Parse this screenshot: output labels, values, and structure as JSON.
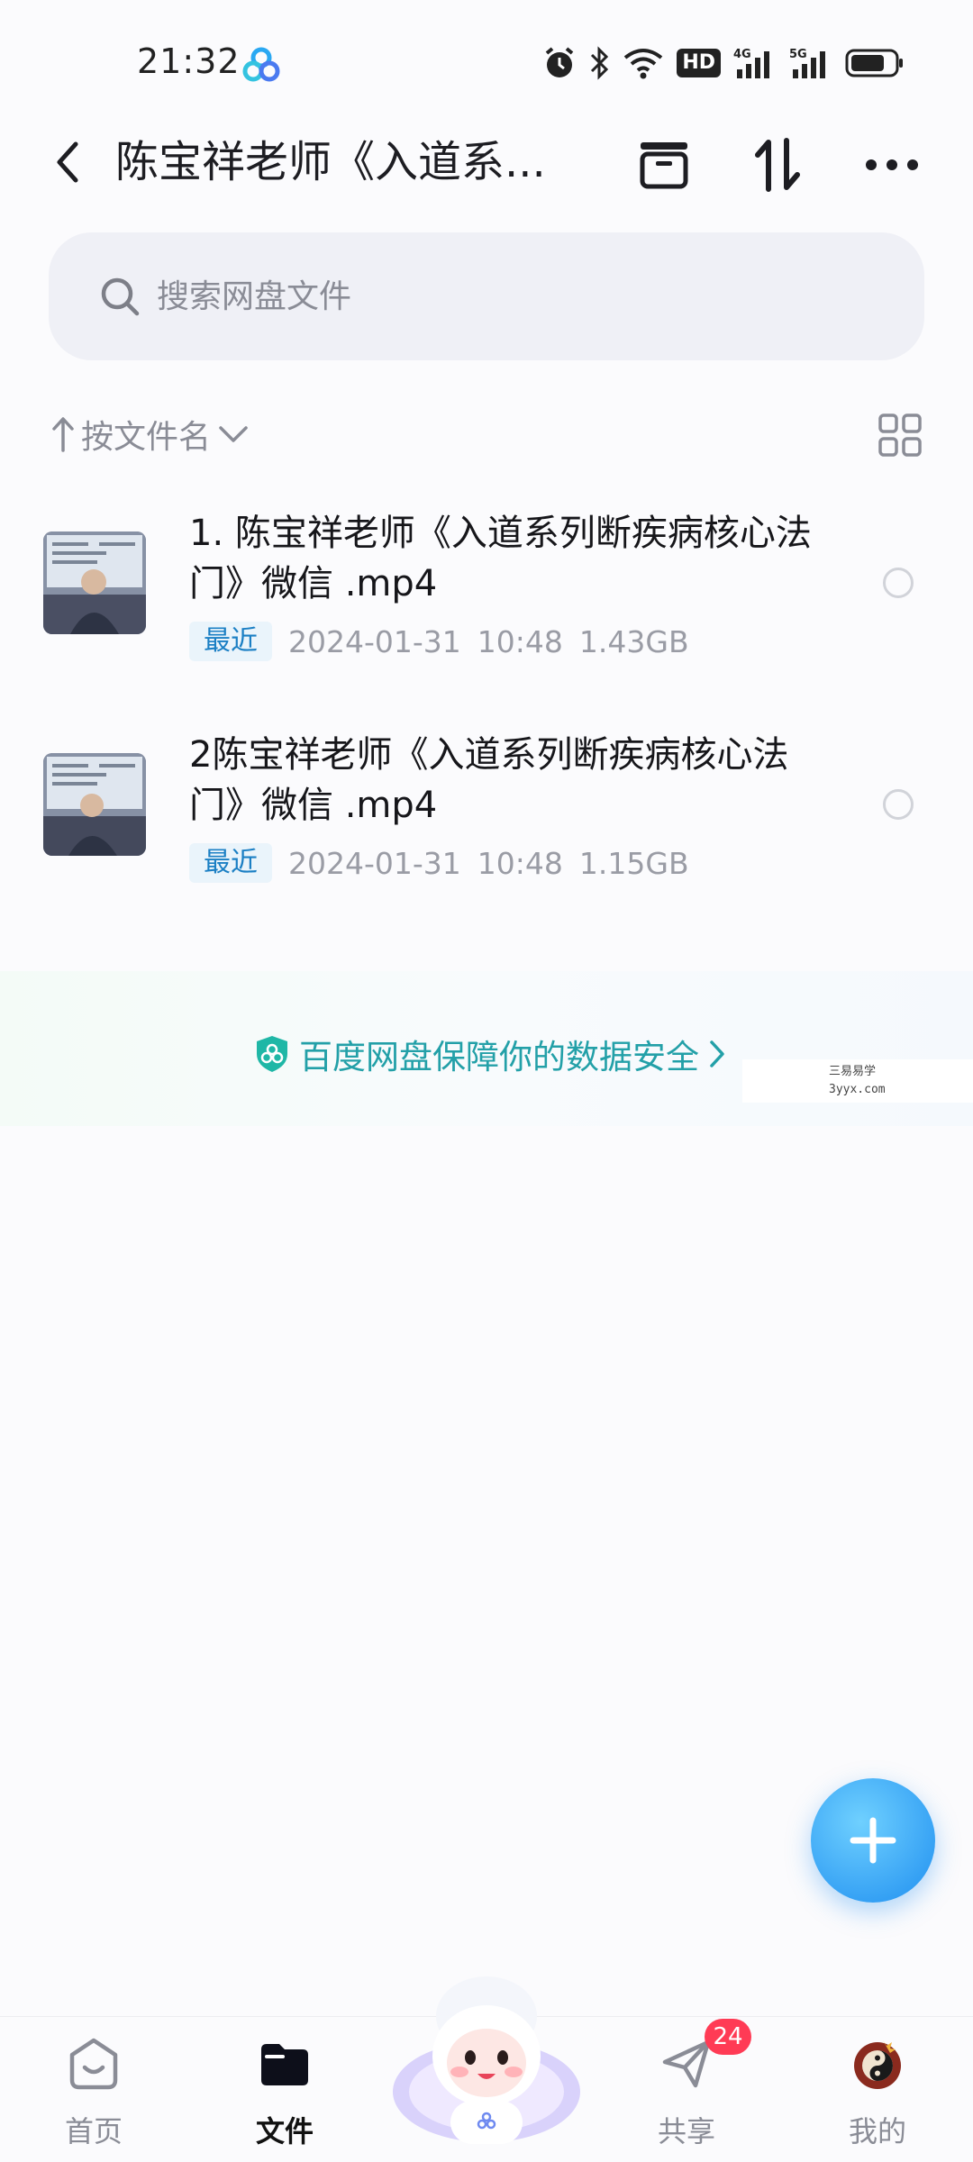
{
  "status_bar": {
    "time": "21:32",
    "hd_label": "HD",
    "net_4g": "4G",
    "net_5g": "5G"
  },
  "header": {
    "title": "陈宝祥老师《入道系..."
  },
  "search": {
    "placeholder": "搜索网盘文件"
  },
  "sort": {
    "label": "按文件名"
  },
  "files": [
    {
      "name": "1. 陈宝祥老师《入道系列断疾病核心法门》微信 .mp4",
      "badge": "最近",
      "date": "2024-01-31",
      "time": "10:48",
      "size": "1.43GB"
    },
    {
      "name": "2陈宝祥老师《入道系列断疾病核心法门》微信 .mp4",
      "badge": "最近",
      "date": "2024-01-31",
      "time": "10:48",
      "size": "1.15GB"
    }
  ],
  "security_banner": {
    "text": "百度网盘保障你的数据安全"
  },
  "watermark": {
    "line1": "三易易学",
    "line2": "3yyx.com"
  },
  "bottom_nav": {
    "items": [
      {
        "label": "首页"
      },
      {
        "label": "文件"
      },
      {
        "label": "共享",
        "badge": "24"
      },
      {
        "label": "我的"
      }
    ]
  },
  "colors": {
    "accent": "#1f8ff0",
    "badge_red": "#ff3b55",
    "security_teal": "#23a0a8"
  }
}
